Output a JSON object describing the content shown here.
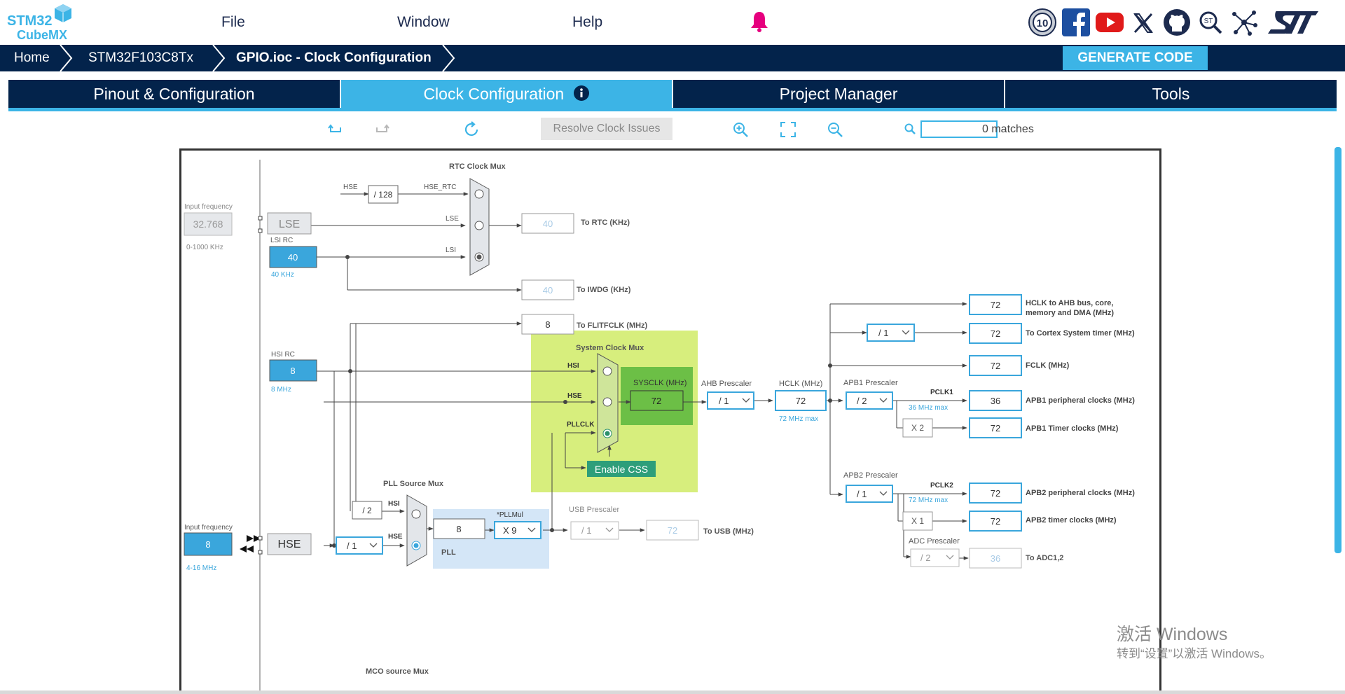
{
  "header": {
    "logo_top": "STM32",
    "logo_bottom": "CubeMX",
    "menus": [
      "File",
      "Window",
      "Help"
    ]
  },
  "breadcrumb": [
    "Home",
    "STM32F103C8Tx",
    "GPIO.ioc - Clock Configuration"
  ],
  "generate_label": "GENERATE CODE",
  "tabs": [
    "Pinout & Configuration",
    "Clock Configuration",
    "Project Manager",
    "Tools"
  ],
  "toolbar": {
    "resolve_label": "Resolve Clock Issues",
    "search_value": "",
    "matches": "0 matches"
  },
  "icons": {
    "undo": "undo-icon",
    "redo": "redo-icon",
    "reset": "refresh-icon",
    "zoom_in": "zoom-in-icon",
    "fit": "fit-screen-icon",
    "zoom_out": "zoom-out-icon",
    "search": "search-icon",
    "bell": "bell-icon",
    "social": [
      "anniversary-10-icon",
      "facebook-icon",
      "youtube-icon",
      "x-icon",
      "github-icon",
      "search-community-icon",
      "network-icon",
      "st-logo-icon"
    ]
  },
  "colors": {
    "navy": "#03234b",
    "accent": "#3cb4e6",
    "green_area": "#d7ee7d",
    "green_box": "#6cbf46",
    "pll_area": "#d4e6f7",
    "bell": "#e6007e"
  },
  "clock": {
    "rtc_mux_title": "RTC Clock Mux",
    "hse_label": "HSE",
    "hse_rtc_label": "HSE_RTC",
    "div128": "/ 128",
    "lse_label_sig": "LSE",
    "lsi_label_sig": "LSI",
    "input_freq_label": "Input frequency",
    "lse_freq": "32.768",
    "lse_range": "0-1000 KHz",
    "lse_box": "LSE",
    "lsi_rc_label": "LSI RC",
    "lsi_value": "40",
    "lsi_unit": "40 KHz",
    "rtc_value": "40",
    "rtc_label": "To RTC (KHz)",
    "iwdg_value": "40",
    "iwdg_label": "To IWDG (KHz)",
    "flit_value": "8",
    "flit_label": "To FLITFCLK (MHz)",
    "hsi_rc_label": "HSI RC",
    "hsi_value": "8",
    "hsi_unit": "8 MHz",
    "sys_mux_title": "System Clock Mux",
    "sig_hsi": "HSI",
    "sig_hse": "HSE",
    "sig_pllclk": "PLLCLK",
    "sysclk_label": "SYSCLK (MHz)",
    "sysclk_value": "72",
    "enable_css": "Enable CSS",
    "ahb_prescaler_label": "AHB Prescaler",
    "ahb_prescaler": "/ 1",
    "hclk_label": "HCLK (MHz)",
    "hclk_value": "72",
    "hclk_max": "72 MHz max",
    "apb1_prescaler_label": "APB1 Prescaler",
    "apb1_prescaler": "/ 2",
    "pclk1_label": "PCLK1",
    "pclk1_max": "36 MHz max",
    "x2": "X 2",
    "apb2_prescaler_label": "APB2 Prescaler",
    "apb2_prescaler": "/ 1",
    "pclk2_label": "PCLK2",
    "pclk2_max": "72 MHz max",
    "x1": "X 1",
    "adc_prescaler_label": "ADC Prescaler",
    "adc_prescaler": "/ 2",
    "cortex_div": "/ 1",
    "outputs": [
      {
        "value": "72",
        "label": "HCLK to AHB bus, core,"
      },
      {
        "value": "72",
        "label": "To Cortex System timer (MHz)"
      },
      {
        "value": "72",
        "label": "FCLK (MHz)"
      },
      {
        "value": "36",
        "label": "APB1 peripheral clocks (MHz)"
      },
      {
        "value": "72",
        "label": "APB1 Timer clocks (MHz)"
      },
      {
        "value": "72",
        "label": "APB2 peripheral clocks (MHz)"
      },
      {
        "value": "72",
        "label": "APB2 timer clocks (MHz)"
      },
      {
        "value": "36",
        "label": "To ADC1,2"
      }
    ],
    "hclk_label2": "memory and DMA (MHz)",
    "pll_source_title": "PLL Source Mux",
    "div2": "/ 2",
    "hse_input_value": "8",
    "hse_range": "4-16 MHz",
    "hse_box": "HSE",
    "hse_prediv": "/ 1",
    "pll_in_value": "8",
    "pllmul_label": "*PLLMul",
    "pllmul_value": "X 9",
    "pll_label": "PLL",
    "usb_prescaler_label": "USB Prescaler",
    "usb_prescaler": "/ 1",
    "usb_value": "72",
    "usb_label": "To USB (MHz)",
    "mco_title": "MCO source Mux"
  },
  "watermark": {
    "line1": "激活 Windows",
    "line2": "转到“设置”以激活 Windows。"
  }
}
